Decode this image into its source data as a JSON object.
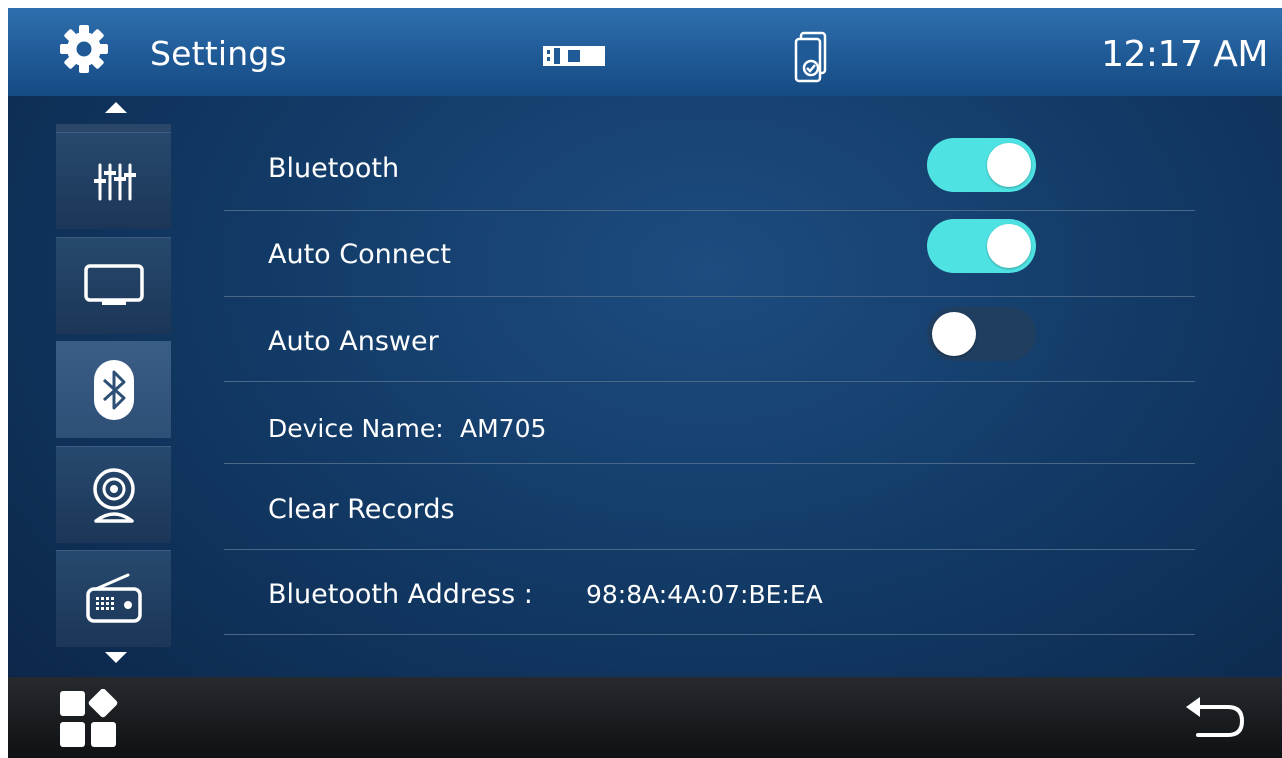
{
  "header": {
    "title": "Settings",
    "time": "12:17 AM",
    "icons": [
      "gear-icon",
      "usb-icon",
      "phone-connection-icon"
    ]
  },
  "sidebar": {
    "items": [
      {
        "name": "equalizer",
        "icon": "equalizer-icon",
        "active": false
      },
      {
        "name": "display",
        "icon": "monitor-icon",
        "active": false
      },
      {
        "name": "bluetooth",
        "icon": "bluetooth-icon",
        "active": true
      },
      {
        "name": "camera",
        "icon": "camera-icon",
        "active": false
      },
      {
        "name": "radio",
        "icon": "radio-icon",
        "active": false
      }
    ]
  },
  "settings": {
    "bluetooth": {
      "label": "Bluetooth",
      "on": true
    },
    "auto_connect": {
      "label": "Auto Connect",
      "on": true
    },
    "auto_answer": {
      "label": "Auto Answer",
      "on": false
    },
    "device_name": {
      "label": "Device Name:",
      "value": "AM705"
    },
    "clear_records": {
      "label": "Clear Records"
    },
    "bt_address": {
      "label": "Bluetooth Address :",
      "value": "98:8A:4A:07:BE:EA"
    }
  },
  "bottom": {
    "icons": [
      "apps-icon",
      "back-icon"
    ]
  },
  "colors": {
    "toggle_on": "#4fe2e2",
    "toggle_off": "#1f3e60",
    "header": "#1f5a96",
    "background": "#123a66"
  }
}
